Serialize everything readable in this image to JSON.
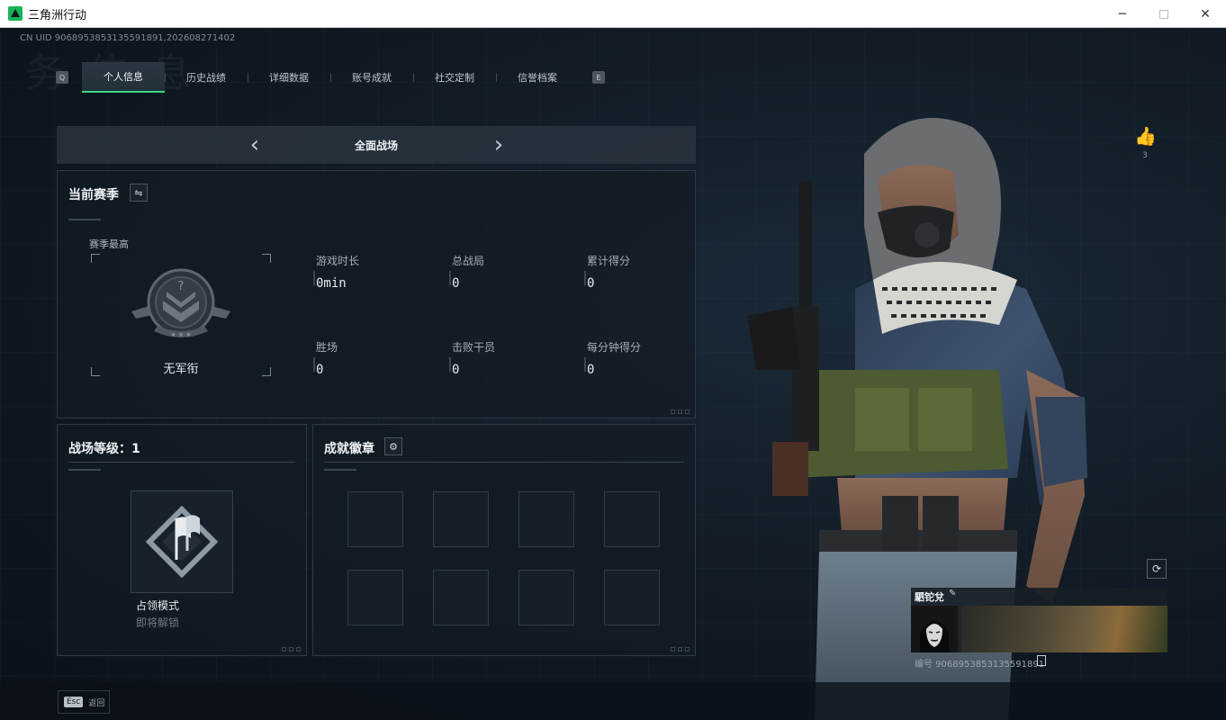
{
  "window": {
    "title": "三角洲行动",
    "min": "─",
    "close": "✕"
  },
  "uid_text": "CN UID 9068953853135591891,202608271402",
  "watermark": "务 信 息",
  "tabs": {
    "left_key": "Q",
    "right_key": "E",
    "items": [
      {
        "label": "个人信息",
        "active": true
      },
      {
        "label": "历史战绩"
      },
      {
        "label": "详细数据"
      },
      {
        "label": "账号成就"
      },
      {
        "label": "社交定制"
      },
      {
        "label": "信誉档案"
      }
    ]
  },
  "mode_selector": {
    "prev": "‹",
    "next": "›",
    "label": "全面战场"
  },
  "season": {
    "title": "当前赛季",
    "swap_icon": "⇋",
    "best_label": "赛季最高",
    "rank_name": "无军衔",
    "stats": [
      {
        "label": "游戏时长",
        "value": "0min"
      },
      {
        "label": "总战局",
        "value": "0"
      },
      {
        "label": "累计得分",
        "value": "0"
      },
      {
        "label": "胜场",
        "value": "0"
      },
      {
        "label": "击败干员",
        "value": "0"
      },
      {
        "label": "每分钟得分",
        "value": "0"
      }
    ]
  },
  "level": {
    "title": "战场等级：1",
    "mode_name": "占领模式",
    "mode_status": "即将解锁"
  },
  "badges": {
    "title": "成就徽章",
    "settings_icon": "⚙",
    "slot_count": 8
  },
  "likes": {
    "icon": "👍",
    "count": "3"
  },
  "refresh_icon": "⟳",
  "player_card": {
    "name": "駟铊兌",
    "edit_icon": "✎",
    "id": "编号 9068953853135591891"
  },
  "footer": {
    "esc_key": "Esc",
    "back_label": "返回"
  }
}
